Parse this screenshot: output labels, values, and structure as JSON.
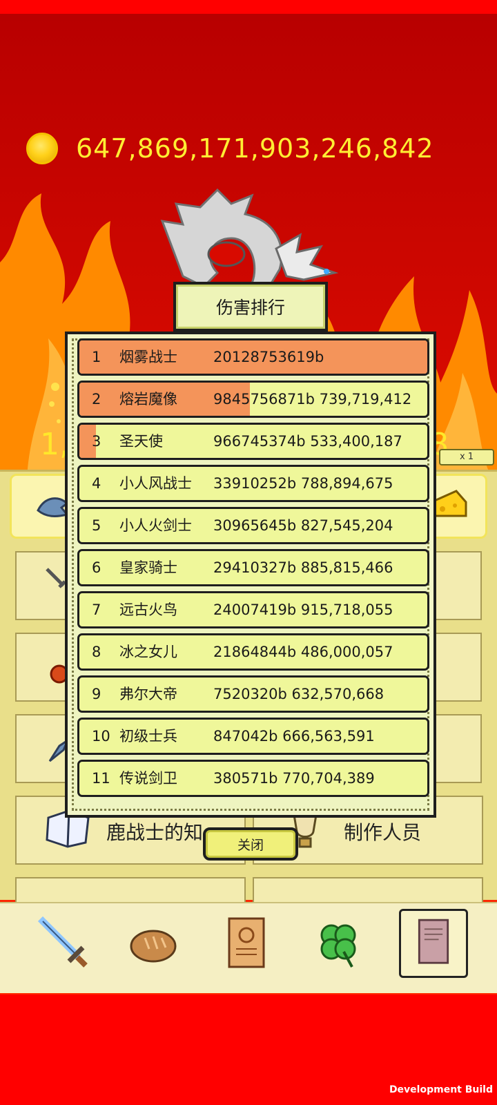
{
  "currency": {
    "amount": "647,869,171,903,246,842"
  },
  "background_partial": {
    "left_text": "1,",
    "right_text": "8",
    "multiplier": "x 1"
  },
  "menu_tiles": {
    "knowledge": "鹿战士的知",
    "credits": "制作人员"
  },
  "ranking_dialog": {
    "title": "伤害排行",
    "close_label": "关闭",
    "rows": [
      {
        "rank": "1",
        "name": "烟雾战士",
        "stats": "20128753619b",
        "fill": 1.0
      },
      {
        "rank": "2",
        "name": "熔岩魔像",
        "stats": "9845756871b 739,719,412",
        "fill": 0.49
      },
      {
        "rank": "3",
        "name": "圣天使",
        "stats": "966745374b 533,400,187",
        "fill": 0.048
      },
      {
        "rank": "4",
        "name": "小人风战士",
        "stats": "33910252b 788,894,675",
        "fill": 0
      },
      {
        "rank": "5",
        "name": "小人火剑士",
        "stats": "30965645b 827,545,204",
        "fill": 0
      },
      {
        "rank": "6",
        "name": "皇家骑士",
        "stats": "29410327b 885,815,466",
        "fill": 0
      },
      {
        "rank": "7",
        "name": "远古火鸟",
        "stats": "24007419b 915,718,055",
        "fill": 0
      },
      {
        "rank": "8",
        "name": "冰之女儿",
        "stats": "21864844b 486,000,057",
        "fill": 0
      },
      {
        "rank": "9",
        "name": "弗尔大帝",
        "stats": "7520320b 632,570,668",
        "fill": 0
      },
      {
        "rank": "10",
        "name": "初级士兵",
        "stats": "847042b 666,563,591",
        "fill": 0
      },
      {
        "rank": "11",
        "name": "传说剑卫",
        "stats": "380571b 770,704,389",
        "fill": 0
      }
    ]
  },
  "bottom_nav": [
    {
      "icon": "sword-icon"
    },
    {
      "icon": "bread-icon"
    },
    {
      "icon": "scroll-icon"
    },
    {
      "icon": "clover-icon"
    },
    {
      "icon": "book-icon",
      "active": true
    }
  ],
  "footer": {
    "dev_build": "Development Build"
  },
  "colors": {
    "background": "#ff0000",
    "row_fill": "#f4945a",
    "row_bg": "#eff79a",
    "gold_text": "#ffee33"
  }
}
